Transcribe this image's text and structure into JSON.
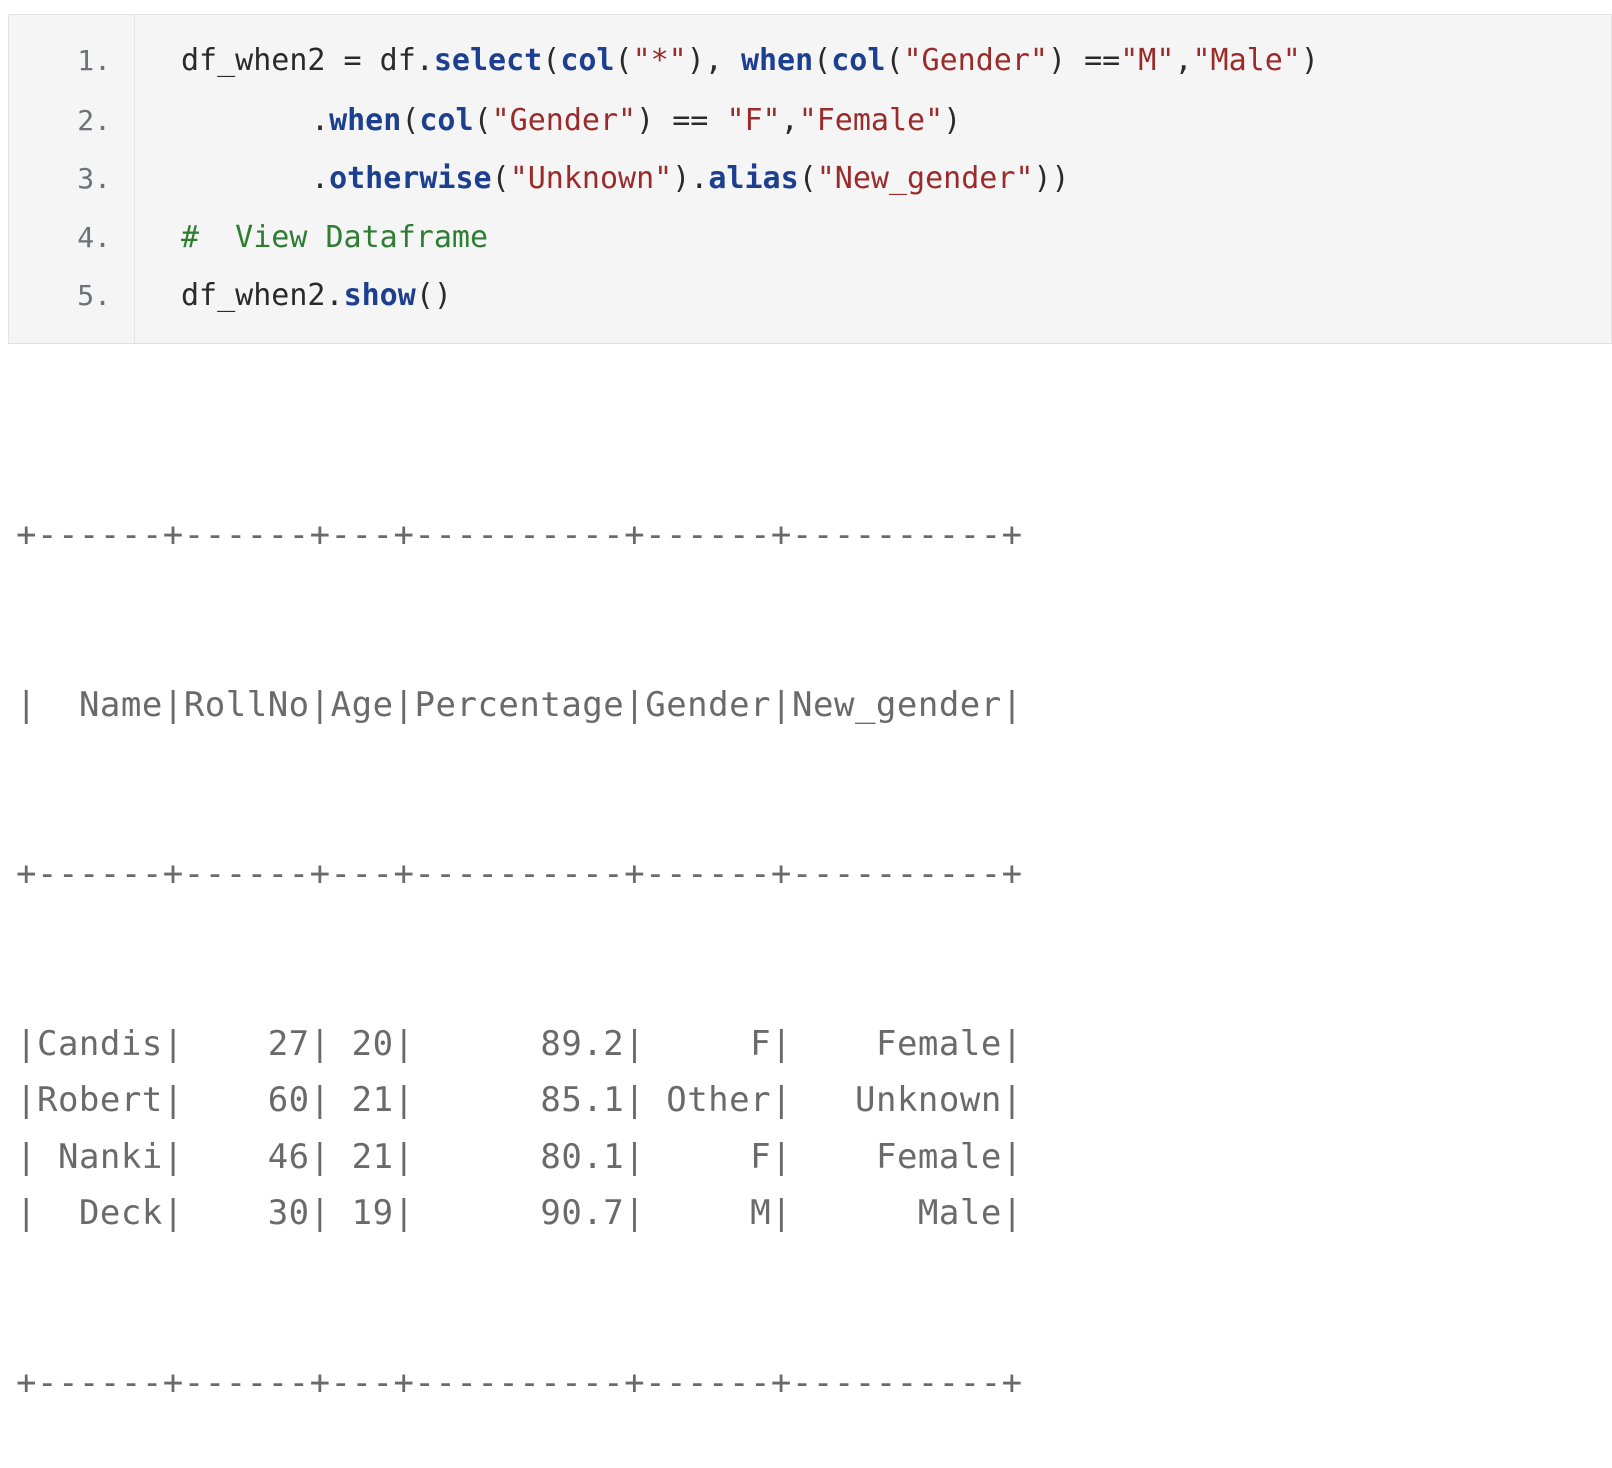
{
  "code": {
    "lines": [
      {
        "num": "1.",
        "segments": [
          {
            "t": "df_when2 = df.",
            "c": "plain"
          },
          {
            "t": "select",
            "c": "fn"
          },
          {
            "t": "(",
            "c": "plain"
          },
          {
            "t": "col",
            "c": "fn"
          },
          {
            "t": "(",
            "c": "plain"
          },
          {
            "t": "\"*\"",
            "c": "str"
          },
          {
            "t": "), ",
            "c": "plain"
          },
          {
            "t": "when",
            "c": "fn"
          },
          {
            "t": "(",
            "c": "plain"
          },
          {
            "t": "col",
            "c": "fn"
          },
          {
            "t": "(",
            "c": "plain"
          },
          {
            "t": "\"Gender\"",
            "c": "str"
          },
          {
            "t": ") ==",
            "c": "plain"
          },
          {
            "t": "\"M\"",
            "c": "str"
          },
          {
            "t": ",",
            "c": "plain"
          },
          {
            "t": "\"Male\"",
            "c": "str"
          },
          {
            "t": ")",
            "c": "plain"
          }
        ]
      },
      {
        "num": "2.",
        "indent": true,
        "segments": [
          {
            "t": ".",
            "c": "plain"
          },
          {
            "t": "when",
            "c": "fn"
          },
          {
            "t": "(",
            "c": "plain"
          },
          {
            "t": "col",
            "c": "fn"
          },
          {
            "t": "(",
            "c": "plain"
          },
          {
            "t": "\"Gender\"",
            "c": "str"
          },
          {
            "t": ") == ",
            "c": "plain"
          },
          {
            "t": "\"F\"",
            "c": "str"
          },
          {
            "t": ",",
            "c": "plain"
          },
          {
            "t": "\"Female\"",
            "c": "str"
          },
          {
            "t": ")",
            "c": "plain"
          }
        ]
      },
      {
        "num": "3.",
        "indent": true,
        "segments": [
          {
            "t": ".",
            "c": "plain"
          },
          {
            "t": "otherwise",
            "c": "fn"
          },
          {
            "t": "(",
            "c": "plain"
          },
          {
            "t": "\"Unknown\"",
            "c": "str"
          },
          {
            "t": ").",
            "c": "plain"
          },
          {
            "t": "alias",
            "c": "fn"
          },
          {
            "t": "(",
            "c": "plain"
          },
          {
            "t": "\"New_gender\"",
            "c": "str"
          },
          {
            "t": "))",
            "c": "plain"
          }
        ]
      },
      {
        "num": "4.",
        "segments": [
          {
            "t": "#  View Dataframe",
            "c": "cmt"
          }
        ]
      },
      {
        "num": "5.",
        "segments": [
          {
            "t": "df_when2.",
            "c": "plain"
          },
          {
            "t": "show",
            "c": "fn"
          },
          {
            "t": "()",
            "c": "plain"
          }
        ]
      }
    ]
  },
  "output": {
    "separator": "+------+------+---+----------+------+----------+",
    "headers": [
      "Name",
      "RollNo",
      "Age",
      "Percentage",
      "Gender",
      "New_gender"
    ],
    "rows": [
      [
        "Candis",
        "27",
        "20",
        "89.2",
        "F",
        "Female"
      ],
      [
        "Robert",
        "60",
        "21",
        "85.1",
        "Other",
        "Unknown"
      ],
      [
        "Nanki",
        "46",
        "21",
        "80.1",
        "F",
        "Female"
      ],
      [
        "Deck",
        "30",
        "19",
        "90.7",
        "M",
        "Male"
      ]
    ]
  },
  "colors": {
    "code_background": "#f5f5f6",
    "function": "#1d3f8f",
    "string": "#9b2b2b",
    "comment": "#2e7d32",
    "line_number": "#6e7177",
    "output_text": "#6a6a6a"
  }
}
